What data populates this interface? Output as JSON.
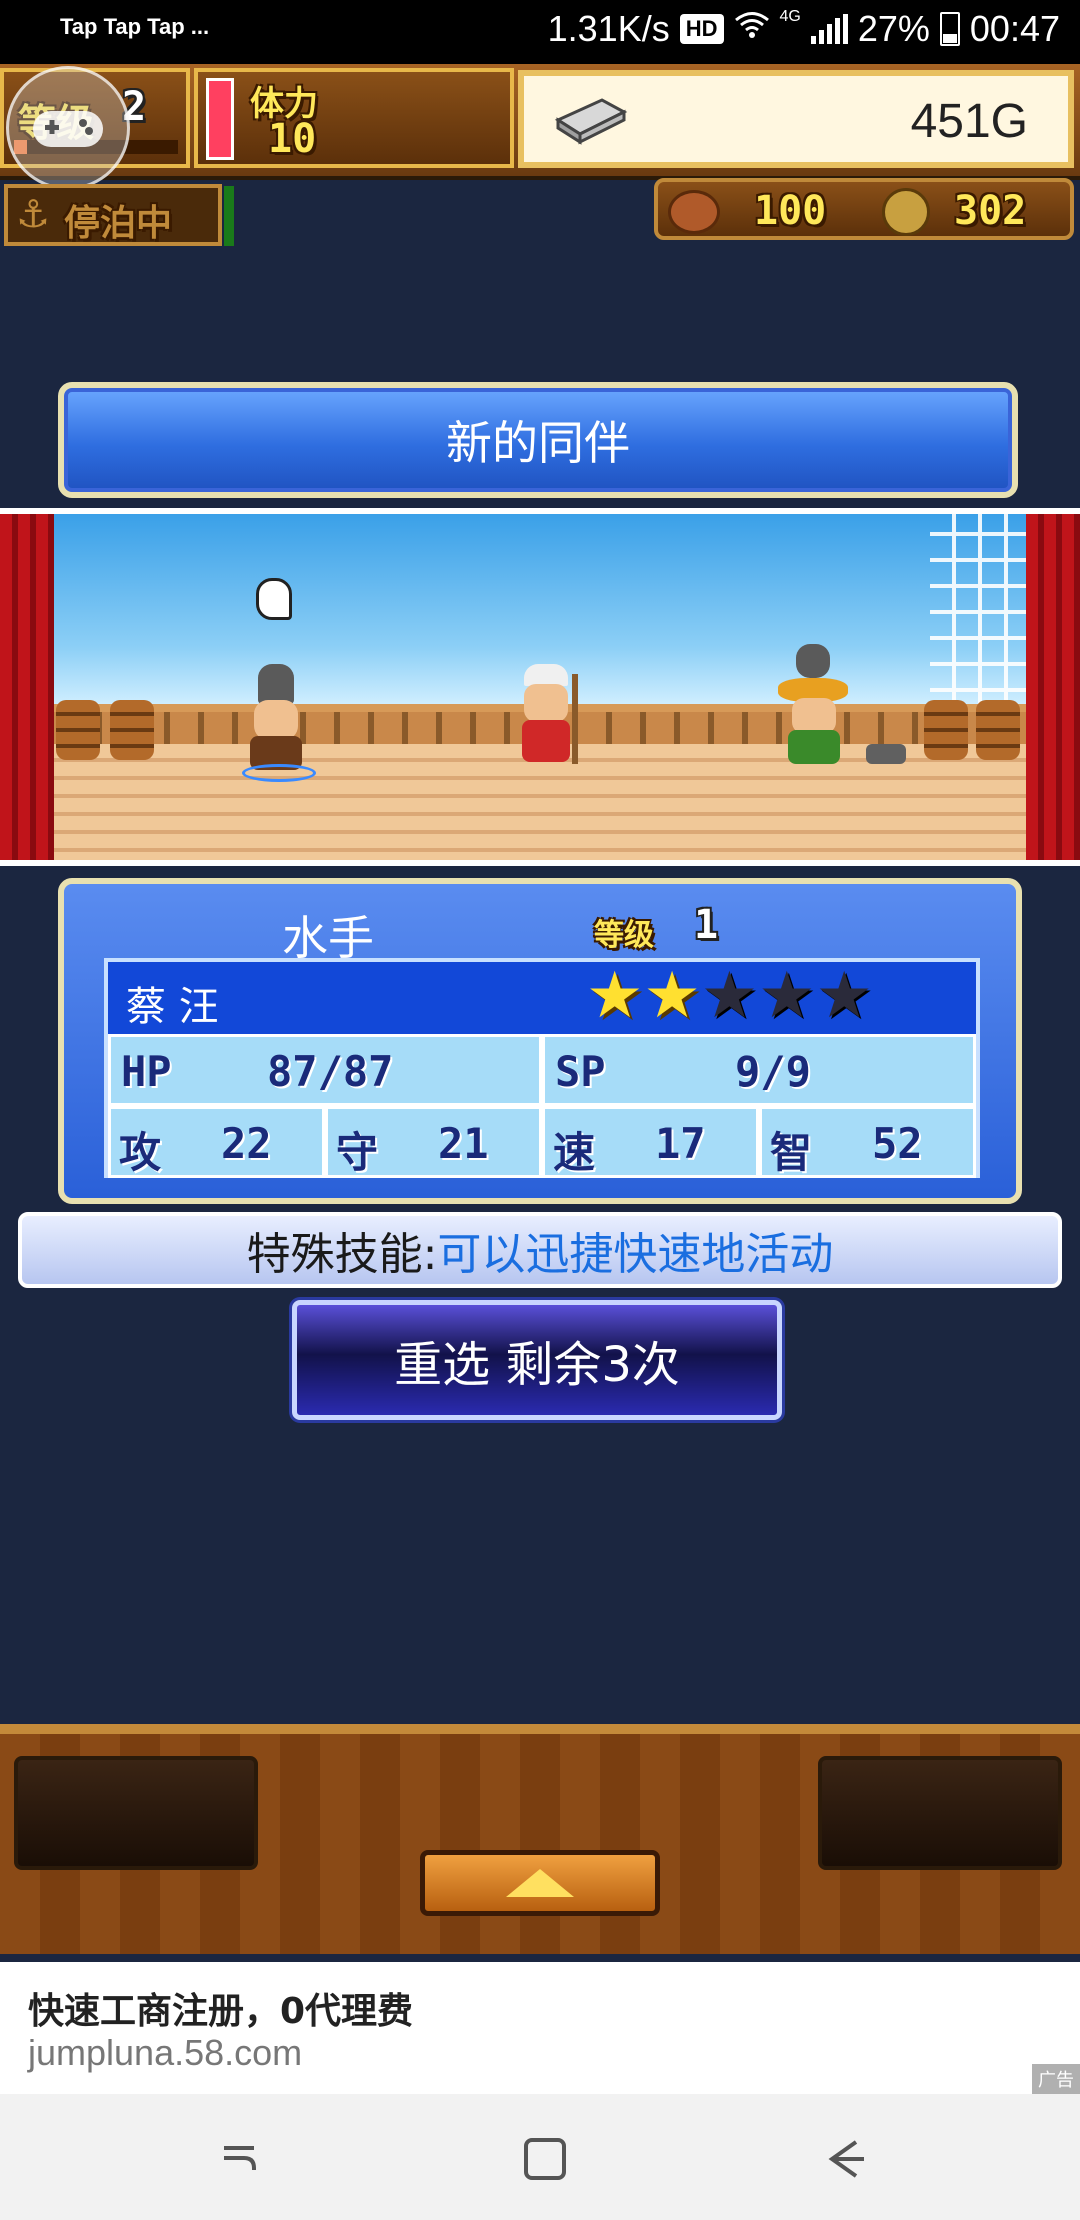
{
  "status_bar": {
    "left_text": "Tap Tap Tap ...",
    "speed": "1.31K/s",
    "hd": "HD",
    "network": "4G",
    "battery": "27%",
    "time": "00:47"
  },
  "top_bar": {
    "level_label": "等级",
    "level_value": "2",
    "stamina_label": "体力",
    "stamina_value": "10",
    "gold": "451G",
    "anchor_status": "停泊中",
    "food": "100",
    "coins": "302"
  },
  "banner": {
    "title": "新的同伴"
  },
  "character": {
    "job": "水手",
    "level_label": "等级",
    "level_value": "1",
    "name": "蔡 汪",
    "stars_filled": 2,
    "stars_total": 5,
    "hp_label": "HP",
    "hp_value": "87/87",
    "sp_label": "SP",
    "sp_value": "9/9",
    "atk_label": "攻",
    "atk_value": "22",
    "def_label": "守",
    "def_value": "21",
    "spd_label": "速",
    "spd_value": "17",
    "int_label": "智",
    "int_value": "52"
  },
  "skill": {
    "label": "特殊技能:",
    "value": "可以迅捷快速地活动"
  },
  "reroll_button": {
    "label": "重选 剩余3次"
  },
  "ad": {
    "title": "快速工商注册，0代理费",
    "url": "jumpluna.58.com",
    "badge": "广告"
  },
  "colors": {
    "background": "#1b2640",
    "panel_blue": "#2a60d8",
    "star_gold": "#ffe030",
    "skill_text": "#1a6ee0"
  }
}
